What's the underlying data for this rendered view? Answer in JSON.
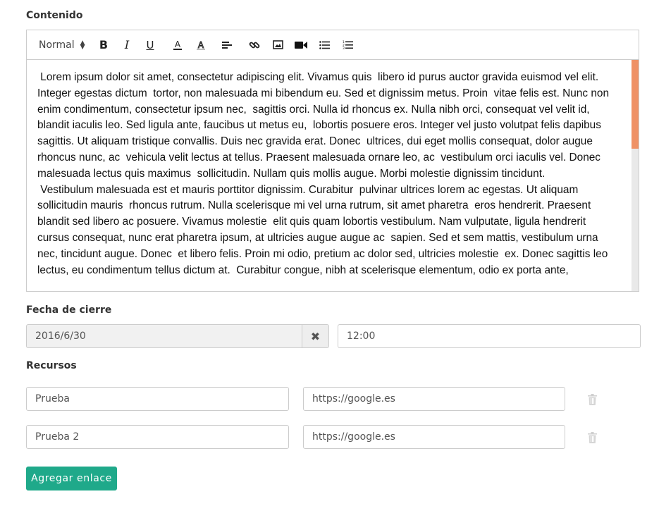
{
  "content_section": {
    "label": "Contenido",
    "toolbar": {
      "format_select": "Normal",
      "icons": [
        "bold-icon",
        "italic-icon",
        "underline-icon",
        "text-color-icon",
        "background-color-icon",
        "align-left-icon",
        "link-icon",
        "image-icon",
        "video-icon",
        "bullet-list-icon",
        "ordered-list-icon"
      ]
    },
    "paragraphs": [
      " Lorem ipsum dolor sit amet, consectetur adipiscing elit. Vivamus quis  libero id purus auctor gravida euismod vel elit. Integer egestas dictum  tortor, non malesuada mi bibendum eu. Sed et dignissim metus. Proin  vitae felis est. Nunc non enim condimentum, consectetur ipsum nec,  sagittis orci. Nulla id rhoncus ex. Nulla nibh orci, consequat vel velit id, blandit iaculis leo. Sed ligula ante, faucibus ut metus eu,  lobortis posuere eros. Integer vel justo volutpat felis dapibus  sagittis. Ut aliquam tristique convallis. Duis nec gravida erat. Donec  ultrices, dui eget mollis consequat, dolor augue rhoncus nunc, ac  vehicula velit lectus at tellus. Praesent malesuada ornare leo, ac  vestibulum orci iaculis vel. Donec malesuada lectus quis maximus  sollicitudin. Nullam quis mollis augue. Morbi molestie dignissim tincidunt.",
      " Vestibulum malesuada est et mauris porttitor dignissim. Curabitur  pulvinar ultrices lorem ac egestas. Ut aliquam sollicitudin mauris  rhoncus rutrum. Nulla scelerisque mi vel urna rutrum, sit amet pharetra  eros hendrerit. Praesent blandit sed libero ac posuere. Vivamus molestie  elit quis quam lobortis vestibulum. Nam vulputate, ligula hendrerit cursus consequat, nunc erat pharetra ipsum, at ultricies augue augue ac  sapien. Sed et sem mattis, vestibulum urna nec, tincidunt augue. Donec  et libero felis. Proin mi odio, pretium ac dolor sed, ultricies molestie  ex. Donec sagittis leo lectus, eu condimentum tellus dictum at.  Curabitur congue, nibh at scelerisque elementum, odio ex porta ante,"
    ]
  },
  "closing_date": {
    "label": "Fecha de cierre",
    "date_value": "2016/6/30",
    "time_value": "12:00"
  },
  "resources": {
    "label": "Recursos",
    "items": [
      {
        "name": "Prueba",
        "url": "https://google.es"
      },
      {
        "name": "Prueba 2",
        "url": "https://google.es"
      }
    ],
    "add_button": "Agregar enlace"
  },
  "colors": {
    "accent": "#1fa98a",
    "scrollbar_thumb": "#ef9165"
  }
}
